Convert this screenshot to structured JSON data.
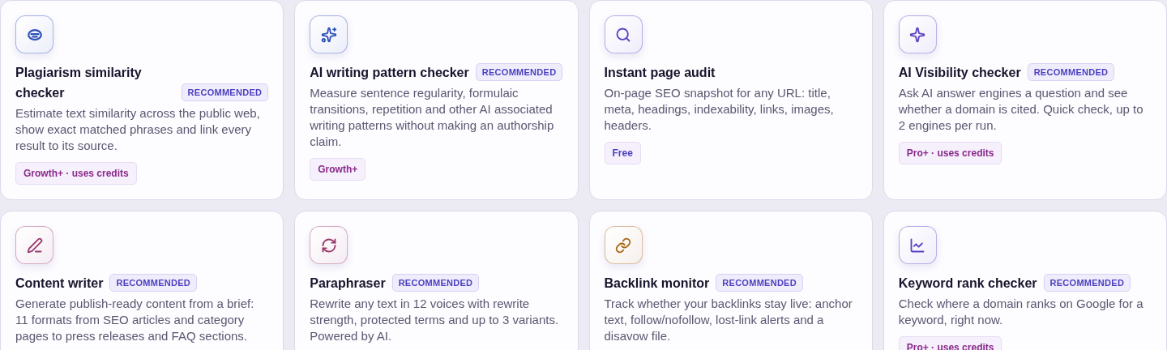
{
  "cards": [
    {
      "kind": "mask",
      "color": "#2c4fb8",
      "title": "Plagiarism similarity checker",
      "badge": "RECOMMENDED",
      "description": "Estimate text similarity across the public web, show exact matched phrases and link every result to its source.",
      "tag": {
        "text": "Growth+ · uses credits",
        "color": "#8a2a8a"
      }
    },
    {
      "kind": "sparkles",
      "color": "#2c4fb8",
      "title": "AI writing pattern checker",
      "badge": "RECOMMENDED",
      "description": "Measure sentence regularity, formulaic transitions, repetition and other AI associated writing patterns without making an authorship claim.",
      "tag": {
        "text": "Growth+",
        "color": "#8a2a8a"
      }
    },
    {
      "kind": "search",
      "color": "#5b3fc4",
      "title": "Instant page audit",
      "description": "On-page SEO snapshot for any URL: title, meta, headings, indexability, links, images, headers.",
      "tag": {
        "text": "Free",
        "color": "#4c3fc0"
      }
    },
    {
      "kind": "sparkle",
      "color": "#5b3fc4",
      "title": "AI Visibility checker",
      "badge": "RECOMMENDED",
      "description": "Ask AI answer engines a question and see whether a domain is cited. Quick check, up to 2 engines per run.",
      "tag": {
        "text": "Pro+ · uses credits",
        "color": "#8a2a8a"
      }
    },
    {
      "kind": "pen",
      "color": "#9a3a6e",
      "title": "Content writer",
      "badge": "RECOMMENDED",
      "description": "Generate publish-ready content from a brief: 11 formats from SEO articles and category pages to press releases and FAQ sections."
    },
    {
      "kind": "refresh",
      "color": "#9a3a6e",
      "title": "Paraphraser",
      "badge": "RECOMMENDED",
      "description": "Rewrite any text in 12 voices with rewrite strength, protected terms and up to 3 variants. Powered by AI."
    },
    {
      "kind": "link",
      "color": "#a86412",
      "title": "Backlink monitor",
      "badge": "RECOMMENDED",
      "description": "Track whether your backlinks stay live: anchor text, follow/nofollow, lost-link alerts and a disavow file."
    },
    {
      "kind": "chart",
      "color": "#5b3fc4",
      "title": "Keyword rank checker",
      "badge": "RECOMMENDED",
      "description": "Check where a domain ranks on Google for a keyword, right now.",
      "tag": {
        "text": "Pro+ · uses credits",
        "color": "#8a2a8a"
      }
    }
  ]
}
